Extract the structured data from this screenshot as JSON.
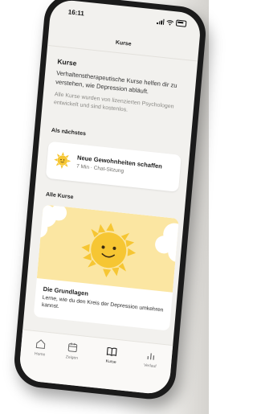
{
  "status_bar": {
    "time": "16:11"
  },
  "header": {
    "title": "Kurse"
  },
  "intro": {
    "title": "Kurse",
    "text": "Verhaltenstherapeutische Kurse helfen dir zu verstehen, wie Depression abläuft.",
    "note": "Alle Kurse wurden von lizenzierten Psychologen entwickelt und sind kostenlos."
  },
  "next_section": {
    "heading": "Als nächstes",
    "item": {
      "title": "Neue Gewohnheiten schaffen",
      "subtitle": "7 Min · Chat-Sitzung",
      "icon": "sun-icon"
    }
  },
  "all_courses": {
    "heading": "Alle Kurse",
    "course": {
      "title": "Die Grundlagen",
      "description": "Lerne, wie du den Kreis der Depression umkehren kannst."
    }
  },
  "tabbar": {
    "items": [
      {
        "label": "Home",
        "icon": "home-icon"
      },
      {
        "label": "Zeigen",
        "icon": "calendar-icon"
      },
      {
        "label": "Kurse",
        "icon": "book-icon",
        "active": true
      },
      {
        "label": "Verlauf",
        "icon": "chart-icon"
      }
    ]
  },
  "colors": {
    "accent_yellow": "#f6c633",
    "card_bg": "#ffffff",
    "screen_bg": "#f2f1ee",
    "illustration_bg": "#fbe6a2"
  }
}
